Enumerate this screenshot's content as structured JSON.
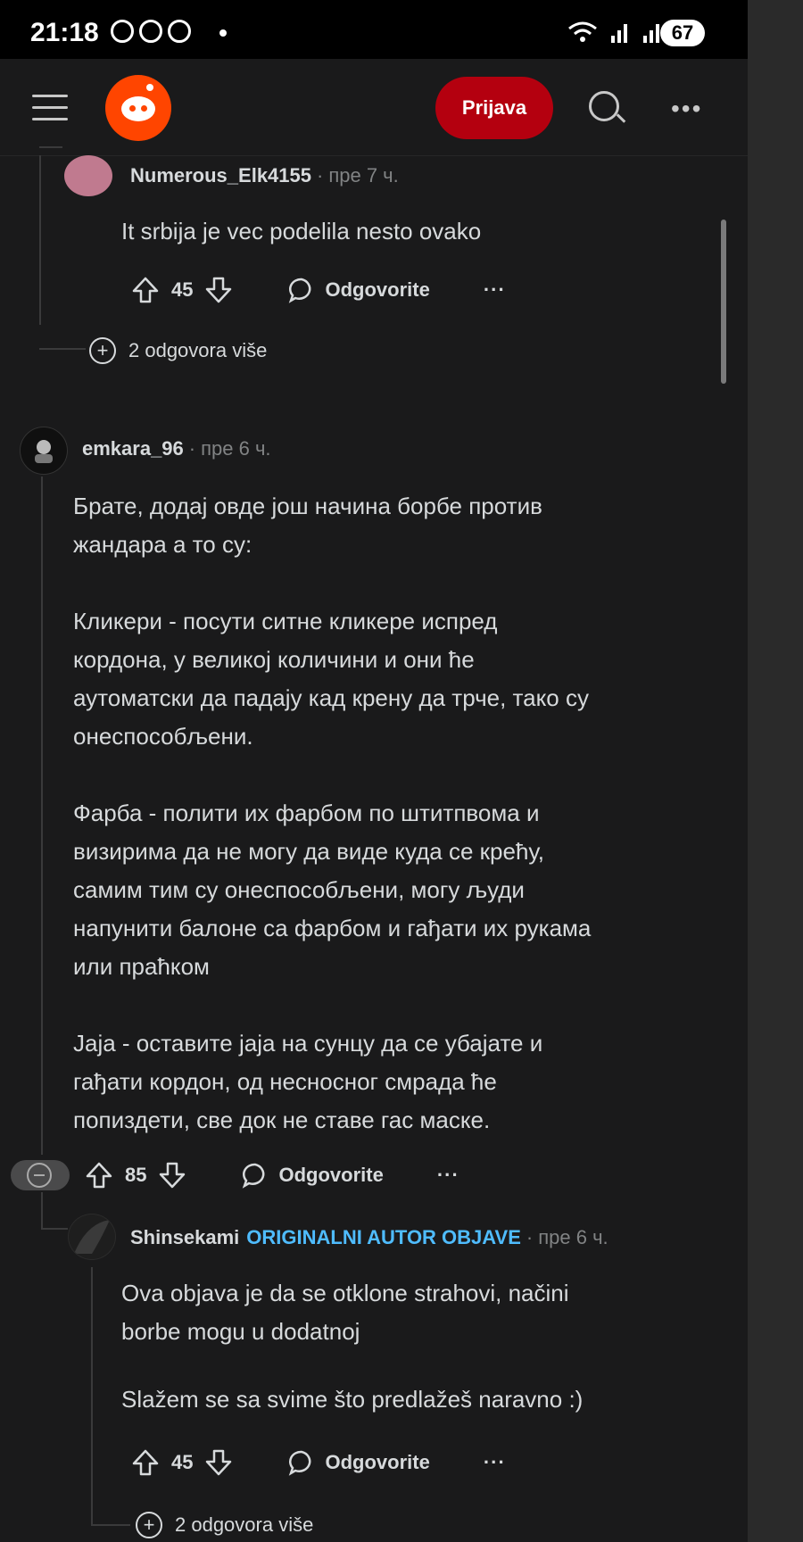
{
  "status_bar": {
    "time": "21:18",
    "battery": "67"
  },
  "header": {
    "login_label": "Prijava"
  },
  "comments": [
    {
      "user": "Numerous_Elk4155",
      "time": "пре 7 ч.",
      "body": [
        "It srbija je vec podelila nesto ovako"
      ],
      "score": "45",
      "reply_label": "Odgovorite",
      "more_replies": "2 odgovora više"
    },
    {
      "user": "emkara_96",
      "time": "пре 6 ч.",
      "body": [
        "Брате, додај овде још начина борбе против\nжандара а то су:",
        "Кликери - посути ситне кликере испред\nкордона, у великој количини и они ће\nаутоматски да падају кад крену да трче, тако су\nонеспособљени.",
        "Фарба - полити их фарбом по штитпвома и\nвизирима да не могу да виде куда се крећу,\nсамим тим су онеспособљени, могу људи\nнапунити балоне са фарбом и гађати их рукама\nили праћком",
        "Јаја - оставите јаја на сунцу да се убајате и\nгађати кордон, од несносног смрада ће\nпопиздети, све док не ставе гас маске."
      ],
      "score": "85",
      "reply_label": "Odgovorite"
    },
    {
      "user": "Shinsekami",
      "op_badge": "ORIGINALNI AUTOR OBJAVE",
      "time": "пре 6 ч.",
      "body": [
        "Ova objava je da se otklone strahovi, načini\nborbe mogu u dodatnoj",
        "Slažem se sa svime što predlažeš naravno :)"
      ],
      "score": "45",
      "reply_label": "Odgovorite",
      "more_replies": "2 odgovora više"
    }
  ]
}
